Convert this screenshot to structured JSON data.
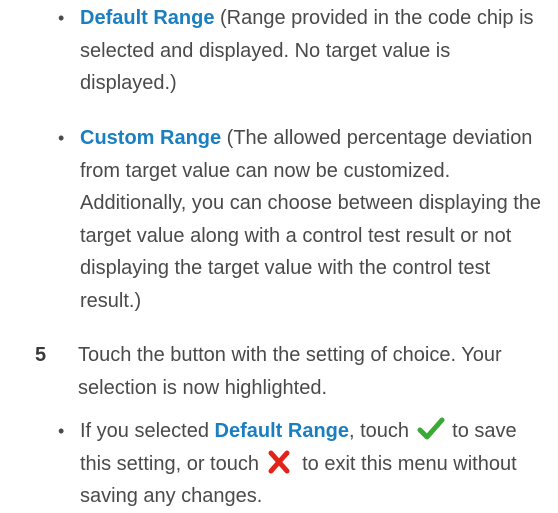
{
  "bullets_top": [
    {
      "term": "Default Range",
      "desc": " (Range provided in the code chip is selected and displayed. No target value is displayed.)"
    },
    {
      "term": "Custom Range",
      "desc": " (The allowed percentage deviation from target value can now be customized. Additionally, you can choose between displaying the target value along with a control test result or not displaying the target value with the control test result.)"
    }
  ],
  "step5": {
    "number": "5",
    "text": "Touch the button with the setting of choice. Your selection is now highlighted."
  },
  "sub_bullet": {
    "prefix": "If you selected ",
    "term": "Default Range",
    "mid1": ", touch ",
    "mid2": " to save this setting, or touch ",
    "mid3": " to exit this menu without saving any changes."
  },
  "icons": {
    "confirm": "checkmark-icon",
    "cancel": "x-mark-icon",
    "confirm_color": "#3aaa35",
    "cancel_color": "#e2231a"
  },
  "colors": {
    "term": "#1a7fc1",
    "text": "#4a4a4a"
  }
}
